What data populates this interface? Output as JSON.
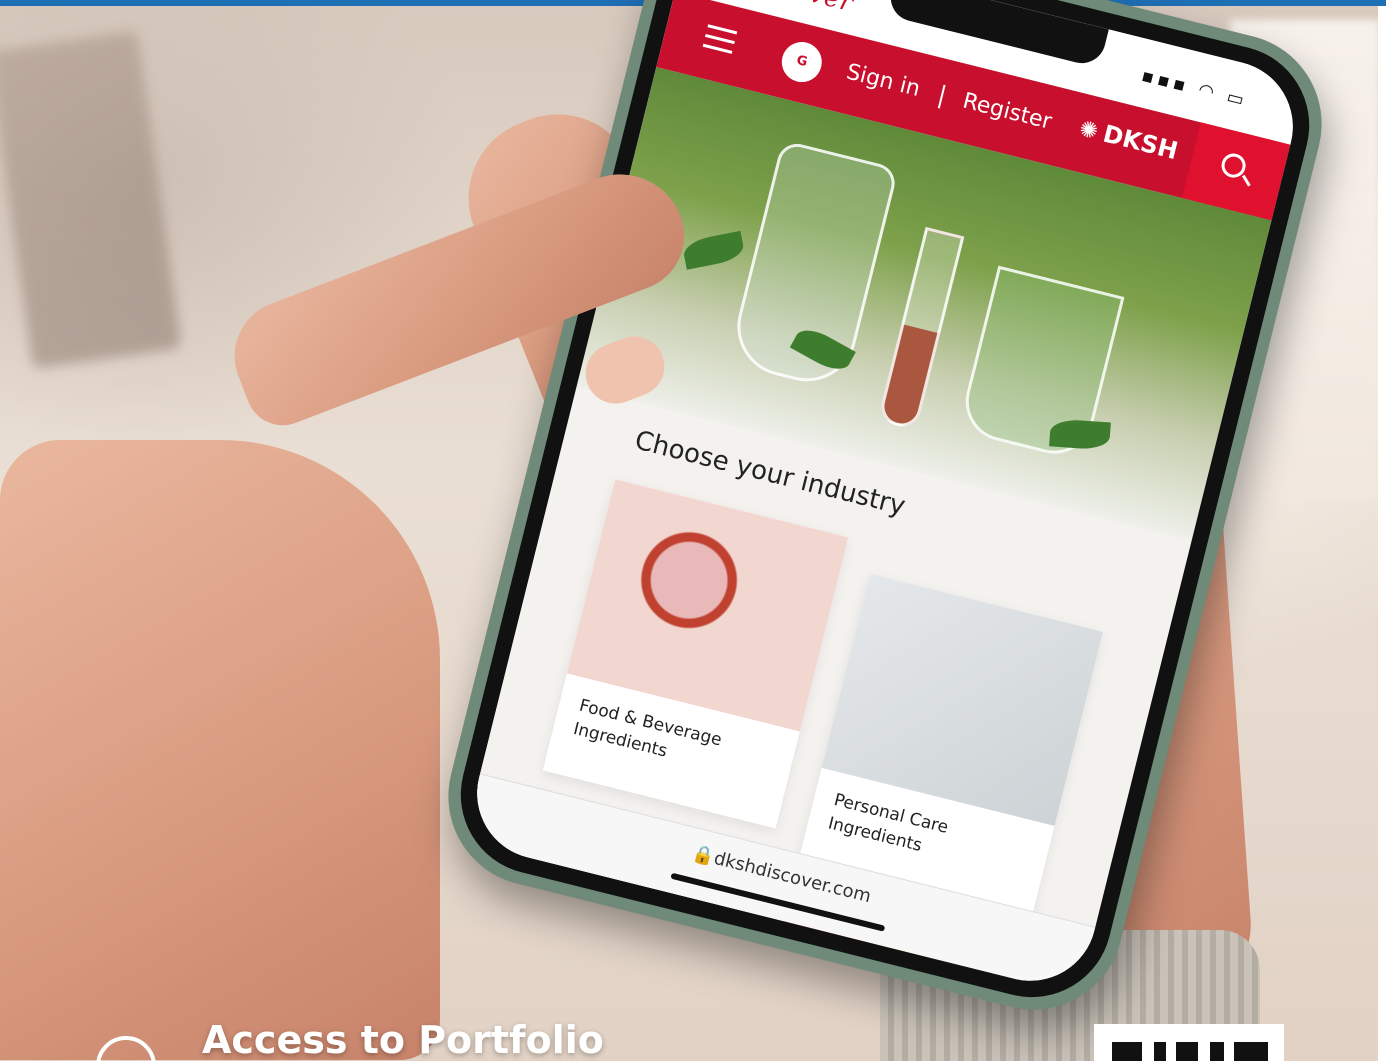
{
  "app": {
    "logo": "Discover",
    "status_icons": "▪▪▪ ◠ ▭"
  },
  "nav": {
    "language_button": "G",
    "sign_in": "Sign in",
    "divider": "|",
    "register": "Register",
    "brand": "DKSH",
    "brand_mark": "✺"
  },
  "main": {
    "section_title": "Choose your industry",
    "cards": [
      {
        "label": "Food & Beverage Ingredients"
      },
      {
        "label": "Personal Care Ingredients"
      }
    ]
  },
  "browser": {
    "url": "🔒dkshdiscover.com"
  },
  "overlay": {
    "caption": "Access to Portfolio"
  },
  "colors": {
    "accent": "#c8102e",
    "top_bar": "#1f6fb5"
  }
}
